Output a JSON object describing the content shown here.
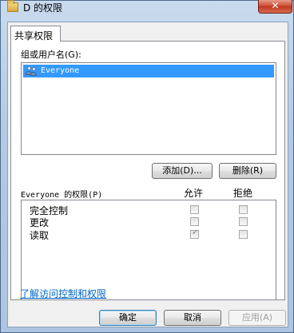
{
  "window": {
    "title": "D 的权限",
    "close_label": "✕"
  },
  "tab": {
    "label": "共享权限"
  },
  "groups": {
    "label": "组或用户名(G):",
    "items": [
      {
        "name": "Everyone",
        "selected": true
      }
    ],
    "add_button": "添加(D)...",
    "remove_button": "删除(R)"
  },
  "permissions": {
    "header": "Everyone 的权限(P)",
    "allow_header": "允许",
    "deny_header": "拒绝",
    "rows": [
      {
        "label": "完全控制",
        "allow": false,
        "deny": false
      },
      {
        "label": "更改",
        "allow": false,
        "deny": false
      },
      {
        "label": "读取",
        "allow": true,
        "deny": false
      }
    ]
  },
  "help_link": "了解访问控制和权限",
  "footer": {
    "ok": "确定",
    "cancel": "取消",
    "apply": "应用(A)"
  }
}
